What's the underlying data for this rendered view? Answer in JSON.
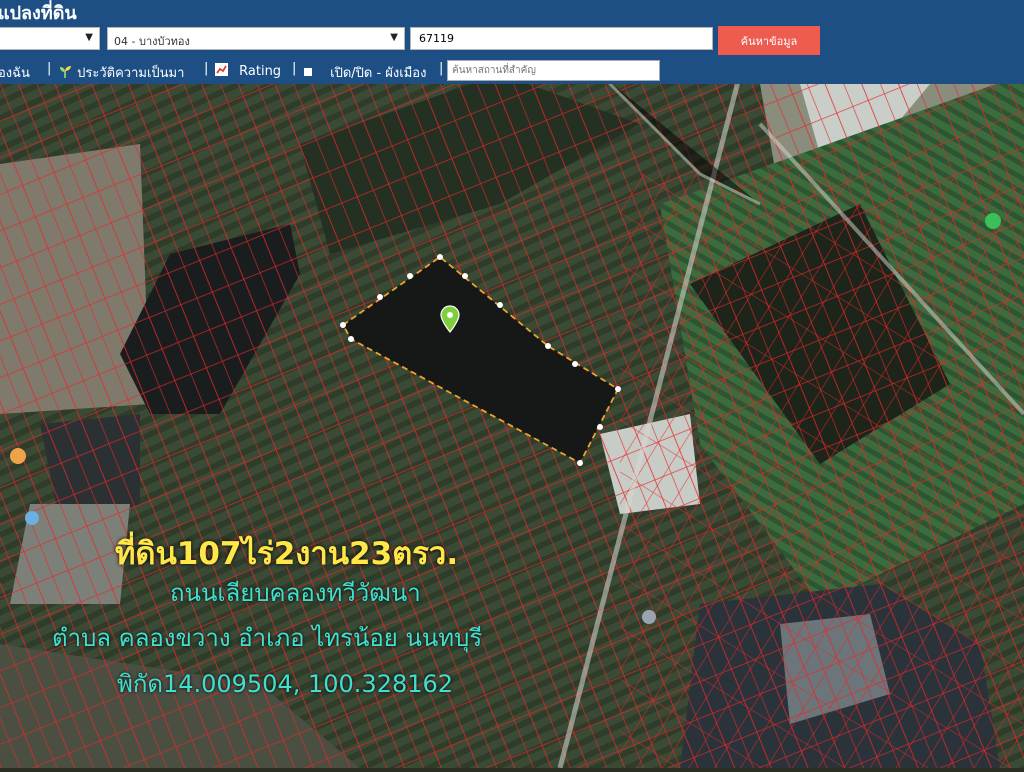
{
  "header": {
    "title": "แปลงที่ดิน",
    "district_select": "04 - บางบัวทอง",
    "parcel_value": "67119",
    "search_label": "ค้นหาข้อมูล"
  },
  "toolbar": {
    "my_location": "องฉัน",
    "history": "ประวัติความเป็นมา",
    "rating": "Rating",
    "town_plan": "เปิด/ปิด - ผังเมือง",
    "landmark_placeholder": "ค้นหาสถานที่สำคัญ"
  },
  "overlay": {
    "area": "ที่ดิน107ไร่2งาน23ตรว.",
    "road": "ถนนเลียบคลองทวีวัฒนา",
    "location": "ตำบล คลองขวาง อำเภอ ไทรน้อย นนทบุรี",
    "coordinates": "พิกัด14.009504, 100.328162"
  },
  "colors": {
    "header_bg": "#1d4f84",
    "search_button": "#ee5c4f",
    "parcel_lines": "#e8262b",
    "area_text": "#ffe74a",
    "info_text": "#3fe0d0"
  }
}
